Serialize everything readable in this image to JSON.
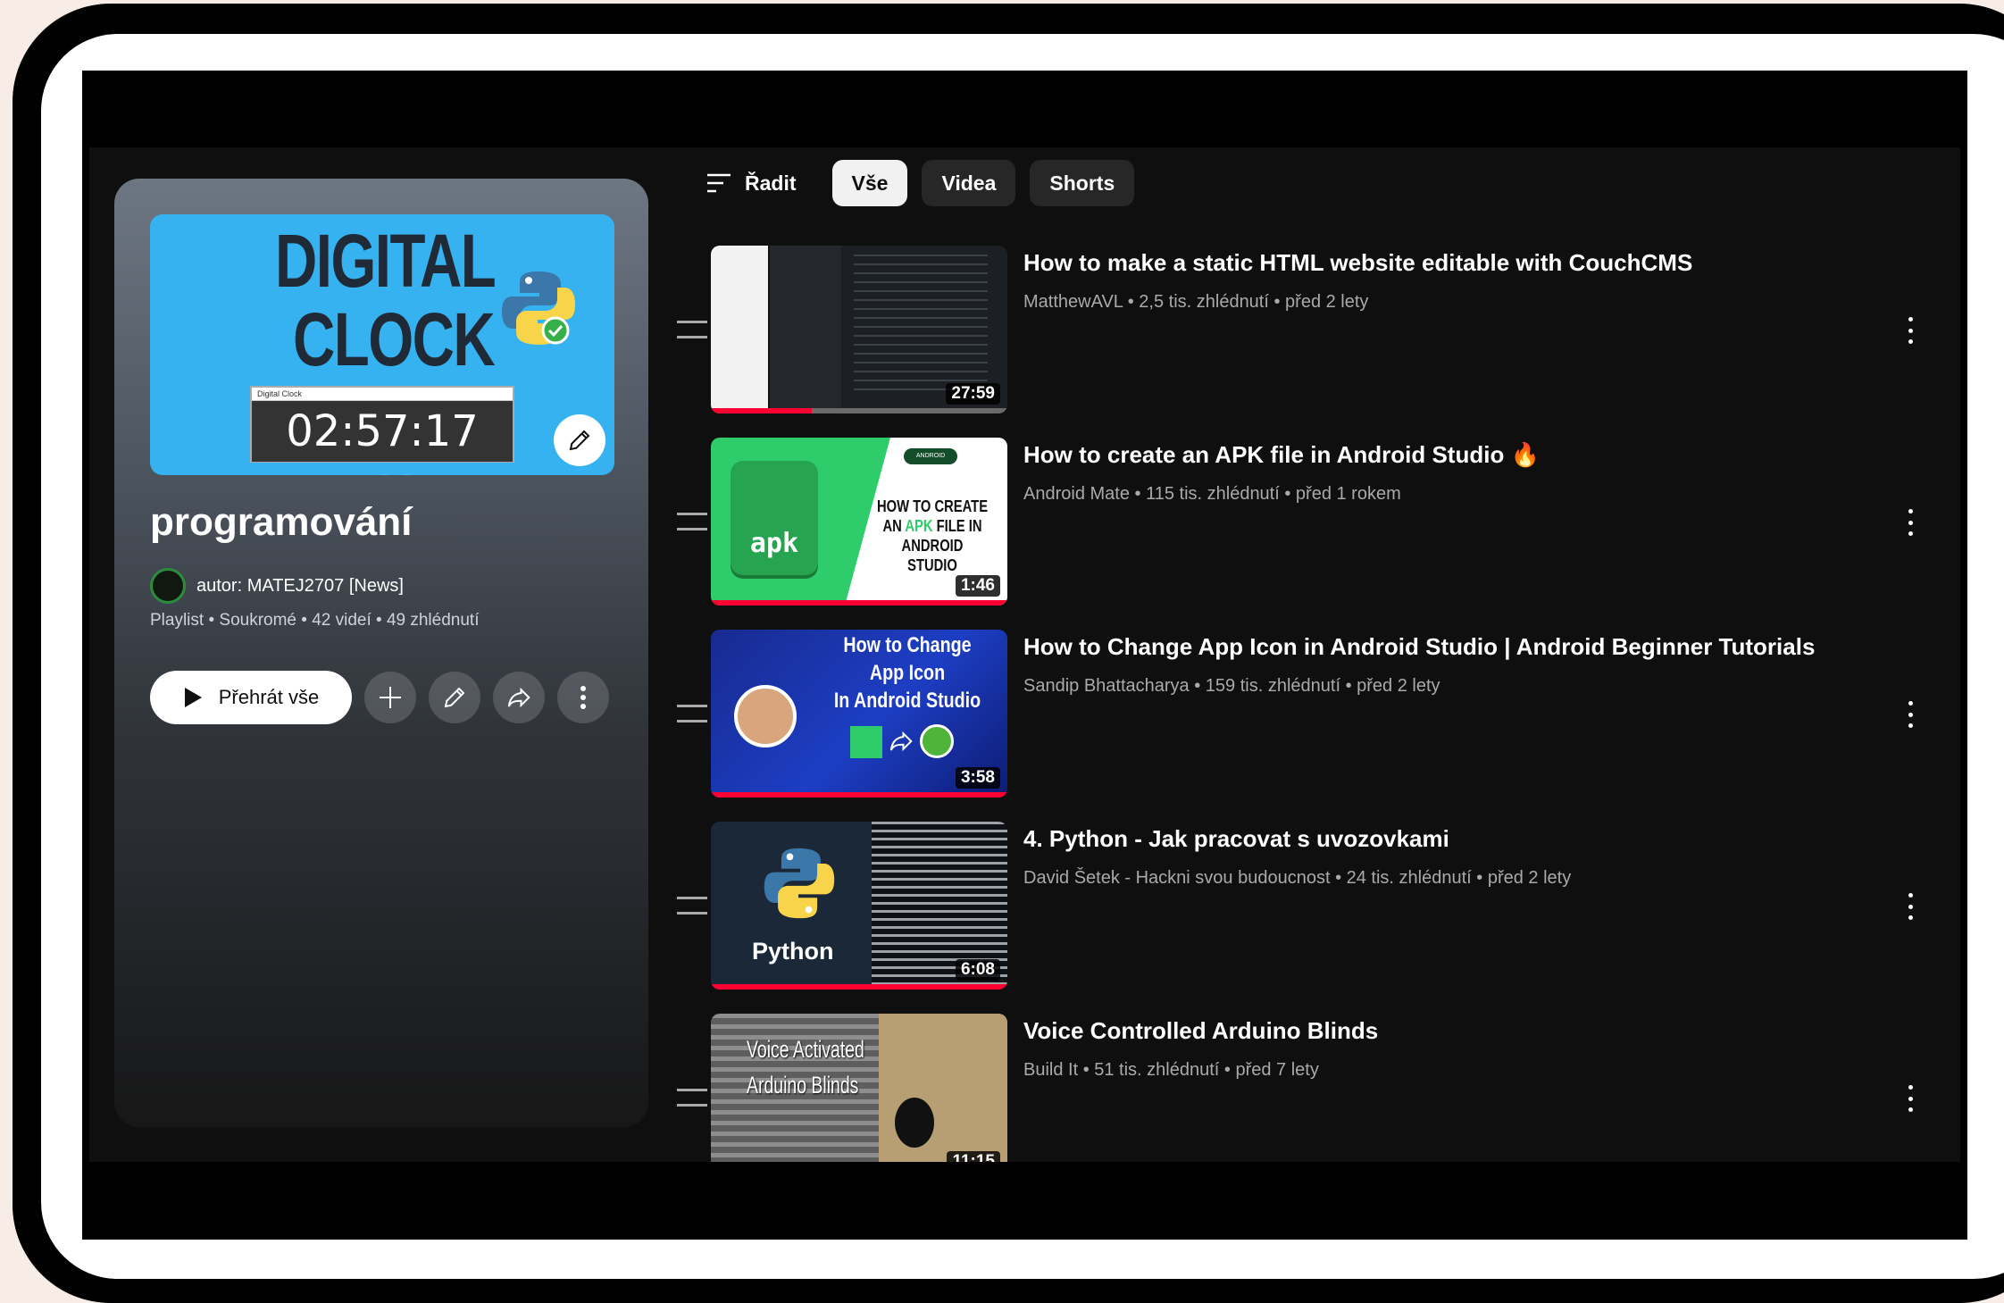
{
  "playlist": {
    "thumbnail": {
      "line1": "DIGITAL",
      "line2": "CLOCK",
      "clock_text": "02:57:17 PM",
      "window_caption": "Digital Clock"
    },
    "title": "programování",
    "owner": "autor: MATEJ2707 [News]",
    "meta": "Playlist • Soukromé • 42 videí • 49 zhlédnutí",
    "play_all_label": "Přehrát vše"
  },
  "filters": {
    "sort_label": "Řadit",
    "chips": [
      "Vše",
      "Videa",
      "Shorts"
    ],
    "active": "Vše"
  },
  "videos": [
    {
      "title": "How to make a static HTML website editable with CouchCMS",
      "meta": "MatthewAVL • 2,5 tis. zhlédnutí • před 2 lety",
      "duration": "27:59",
      "progress": 0.34
    },
    {
      "title": "How to create an APK file in Android Studio 🔥",
      "meta": "Android Mate • 115 tis. zhlédnutí • před 1 rokem",
      "duration": "1:46",
      "progress": 1.0,
      "thumb": {
        "badge": "apk",
        "line1": "HOW TO CREATE",
        "line2a": "AN ",
        "line2b": "APK",
        "line2c": " FILE IN",
        "line3": "ANDROID STUDIO",
        "logo": "ANDROID STUDIO"
      }
    },
    {
      "title": "How to Change App Icon in Android Studio | Android Beginner Tutorials",
      "meta": "Sandip Bhattacharya • 159 tis. zhlédnutí • před 2 lety",
      "duration": "3:58",
      "progress": 1.0,
      "thumb": {
        "line1": "How to Change",
        "line2": "App Icon",
        "line3": "In Android Studio"
      }
    },
    {
      "title": "4. Python - Jak pracovat s uvozovkami",
      "meta": "David Šetek - Hackni svou budoucnost • 24 tis. zhlédnutí • před 2 lety",
      "duration": "6:08",
      "progress": 1.0,
      "thumb": {
        "label": "Python"
      }
    },
    {
      "title": "Voice Controlled Arduino Blinds",
      "meta": "Build It • 51 tis. zhlédnutí • před 7 lety",
      "duration": "11:15",
      "progress": 0,
      "thumb": {
        "line1": "Voice Activated",
        "line2": "Arduino Blinds"
      }
    }
  ],
  "colors": {
    "accent_red": "#ff0033",
    "background": "#0f0f0f",
    "chip_bg": "#272727"
  }
}
